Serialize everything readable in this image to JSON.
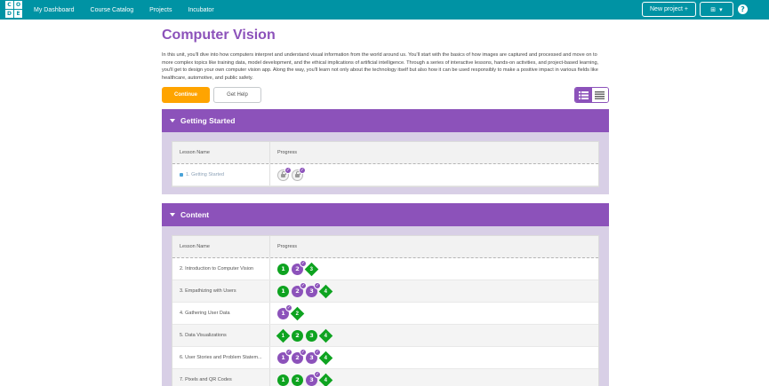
{
  "nav": {
    "logo_letters": [
      "C",
      "O",
      "D",
      "E"
    ],
    "items": [
      "My Dashboard",
      "Course Catalog",
      "Projects",
      "Incubator"
    ],
    "new_project": "New project +",
    "apps_label": "⊞",
    "help": "?"
  },
  "unit": {
    "title": "Computer Vision",
    "description": "In this unit, you'll dive into how computers interpret and understand visual information from the world around us. You'll start with the basics of how images are captured and processed and move on to more complex topics like training data, model development, and the ethical implications of artificial intelligence. Through a series of interactive lessons, hands-on activities, and project-based learning, you'll get to design your own computer vision app. Along the way, you'll learn not only about the technology itself but also how it can be used responsibly to make a positive impact in various fields like healthcare, automotive, and public safety.",
    "continue": "Continue",
    "get_help": "Get Help"
  },
  "table_headers": {
    "lesson": "Lesson Name",
    "progress": "Progress"
  },
  "sections": [
    {
      "title": "Getting Started",
      "lessons": [
        {
          "name": "1. Getting Started",
          "locked": true
        }
      ]
    },
    {
      "title": "Content",
      "lessons": [
        {
          "name": "2. Introduction to Computer Vision"
        },
        {
          "name": "3. Empathizing with Users"
        },
        {
          "name": "4. Gathering User Data"
        },
        {
          "name": "5. Data Visualizations"
        },
        {
          "name": "6. User Stories and Problem Statem..."
        },
        {
          "name": "7. Pixels and QR Codes"
        }
      ]
    }
  ],
  "bubbles": {
    "n1": "1",
    "n2": "2",
    "n3": "3",
    "n4": "4",
    "check": "✓"
  },
  "colors": {
    "teal": "#0093a4",
    "purple": "#8c52ba",
    "green": "#0ea320",
    "orange": "#ffa400"
  }
}
